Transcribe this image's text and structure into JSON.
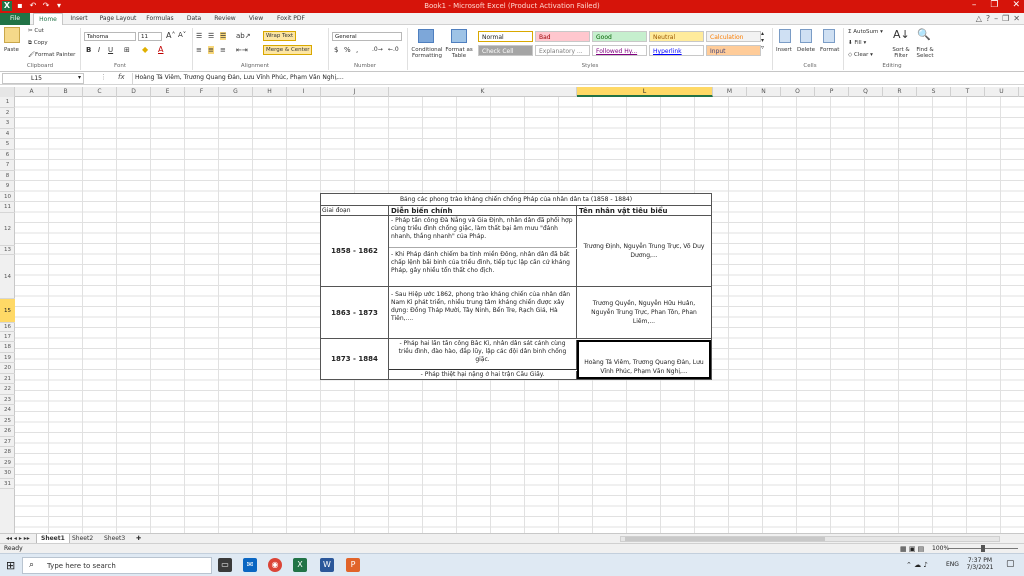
{
  "window": {
    "title": "Book1 - Microsoft Excel (Product Activation Failed)"
  },
  "tabs": [
    "File",
    "Home",
    "Insert",
    "Page Layout",
    "Formulas",
    "Data",
    "Review",
    "View",
    "Foxit PDF"
  ],
  "ribbon": {
    "clipboard": {
      "paste": "Paste",
      "cut": "Cut",
      "copy": "Copy",
      "format_painter": "Format Painter",
      "label": "Clipboard"
    },
    "font": {
      "name": "Tahoma",
      "size": "11",
      "label": "Font"
    },
    "alignment": {
      "wrap": "Wrap Text",
      "merge": "Merge & Center",
      "label": "Alignment"
    },
    "number": {
      "format": "General",
      "label": "Number",
      "pct": "%",
      "comma": ","
    },
    "styles": {
      "conditional": "Conditional Formatting",
      "format_table": "Format as Table",
      "label": "Styles",
      "items": [
        {
          "name": "Normal",
          "bg": "#ffffff",
          "fg": "#222222"
        },
        {
          "name": "Bad",
          "bg": "#ffc7ce",
          "fg": "#9c0006"
        },
        {
          "name": "Good",
          "bg": "#c6efce",
          "fg": "#006100"
        },
        {
          "name": "Neutral",
          "bg": "#ffeb9c",
          "fg": "#9c5700"
        },
        {
          "name": "Calculation",
          "bg": "#f2f2f2",
          "fg": "#fa7d00"
        },
        {
          "name": "Check Cell",
          "bg": "#a5a5a5",
          "fg": "#ffffff"
        },
        {
          "name": "Explanatory ...",
          "bg": "#ffffff",
          "fg": "#7f7f7f"
        },
        {
          "name": "Followed Hy...",
          "bg": "#ffffff",
          "fg": "#800080"
        },
        {
          "name": "Hyperlink",
          "bg": "#ffffff",
          "fg": "#0000ff"
        },
        {
          "name": "Input",
          "bg": "#ffcc99",
          "fg": "#3f3f76"
        }
      ]
    },
    "cells": {
      "insert": "Insert",
      "delete": "Delete",
      "format": "Format",
      "label": "Cells"
    },
    "editing": {
      "autosum": "AutoSum",
      "fill": "Fill",
      "clear": "Clear",
      "sort": "Sort & Filter",
      "find": "Find & Select",
      "label": "Editing"
    }
  },
  "formula_bar": {
    "name_box": "L15",
    "fx": "fx",
    "content": "Hoàng Tá Viêm, Trương Quang Đản, Lưu Vĩnh Phúc, Phạm Văn Nghị,..."
  },
  "columns": [
    {
      "n": "A",
      "w": 34
    },
    {
      "n": "B",
      "w": 34
    },
    {
      "n": "C",
      "w": 34
    },
    {
      "n": "D",
      "w": 34
    },
    {
      "n": "E",
      "w": 34
    },
    {
      "n": "F",
      "w": 34
    },
    {
      "n": "G",
      "w": 34
    },
    {
      "n": "H",
      "w": 34
    },
    {
      "n": "I",
      "w": 34
    },
    {
      "n": "J",
      "w": 68
    },
    {
      "n": "K",
      "w": 188
    },
    {
      "n": "L",
      "w": 136
    },
    {
      "n": "M",
      "w": 34
    },
    {
      "n": "N",
      "w": 34
    },
    {
      "n": "O",
      "w": 34
    },
    {
      "n": "P",
      "w": 34
    },
    {
      "n": "Q",
      "w": 34
    },
    {
      "n": "R",
      "w": 34
    },
    {
      "n": "S",
      "w": 34
    },
    {
      "n": "T",
      "w": 34
    },
    {
      "n": "U",
      "w": 34
    }
  ],
  "selected_col": "L",
  "rows": [
    "1",
    "2",
    "3",
    "4",
    "5",
    "6",
    "7",
    "8",
    "9",
    "10",
    "11",
    "12",
    "13",
    "14",
    "15",
    "16",
    "17",
    "18",
    "19",
    "20",
    "21",
    "22",
    "23",
    "24",
    "25",
    "26",
    "27",
    "28",
    "29",
    "30",
    "31"
  ],
  "selected_row": "15",
  "table": {
    "title": "Bảng các phong trào kháng chiến chống Pháp của nhân dân ta (1858 - 1884)",
    "headers": [
      "Giai đoạn",
      "Diễn biến chính",
      "Tên nhân vật tiêu biểu"
    ],
    "p1": {
      "period": "1858 - 1862",
      "e1": "- Pháp tấn công Đà Nẵng và Gia Định, nhân dân đã phối hợp cùng triều đình chống giặc, làm thất bại âm mưu \"đánh nhanh, thắng nhanh\" của Pháp.",
      "e2": "- Khi Pháp đánh chiếm ba tỉnh miền Đông, nhân dân đã bất chấp lệnh bãi binh của triều đình, tiếp tục lập căn cứ kháng Pháp, gây nhiều tổn thất cho địch.",
      "people": "Trương Định, Nguyễn Trung Trực, Võ Duy Dương,..."
    },
    "p2": {
      "period": "1863 - 1873",
      "e1": "- Sau Hiệp ước 1862, phong trào kháng chiến của nhân dân Nam Kì phát triển, nhiều trung tâm kháng chiến được xây dựng: Đồng Tháp Mười, Tây Ninh, Bến Tre, Rạch Giá, Hà Tiên,....",
      "people": "Trương Quyền, Nguyễn Hữu Huân, Nguyễn Trung Trực, Phan Tôn, Phan Liêm,..."
    },
    "p3": {
      "period": "1873 - 1884",
      "e1": "- Pháp hai lần tấn công Bắc Kì, nhân dân sát cánh cùng triều đình, đào hào, đắp lũy, lập các đội dân binh chống giặc.",
      "e2": "- Pháp thiệt hại nặng ở hai trận Cầu Giấy.",
      "people": "Hoàng Tá Viêm, Trương Quang Đản, Lưu Vĩnh Phúc, Phạm Văn Nghị,..."
    }
  },
  "sheets": [
    "Sheet1",
    "Sheet2",
    "Sheet3"
  ],
  "status": {
    "ready": "Ready",
    "zoom": "100%"
  },
  "taskbar": {
    "search": "Type here to search",
    "time": "7:37 PM",
    "date": "7/3/2021",
    "lang": "ENG"
  }
}
